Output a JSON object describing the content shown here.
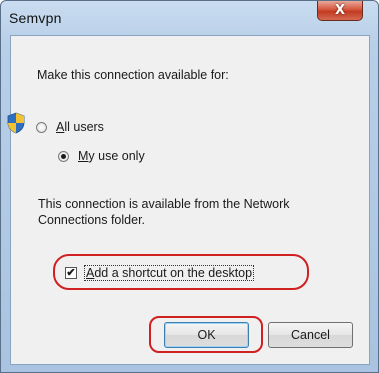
{
  "window": {
    "title": "Semvpn",
    "close_glyph": "X"
  },
  "prompt": "Make this connection available for:",
  "radios": [
    {
      "label_prefix": "",
      "accel": "A",
      "label_rest": "ll users",
      "checked": false
    },
    {
      "label_prefix": "",
      "accel": "M",
      "label_rest": "y use only",
      "checked": true
    }
  ],
  "info_text": "This connection is available from the Network Connections folder.",
  "shortcut": {
    "label_prefix": "",
    "accel": "A",
    "label_rest": "dd a shortcut on the desktop",
    "checked": true,
    "check_glyph": "✔"
  },
  "buttons": {
    "ok": "OK",
    "cancel": "Cancel"
  },
  "icons": {
    "shield": "uac-shield-icon"
  },
  "colors": {
    "highlight": "#d02020"
  }
}
